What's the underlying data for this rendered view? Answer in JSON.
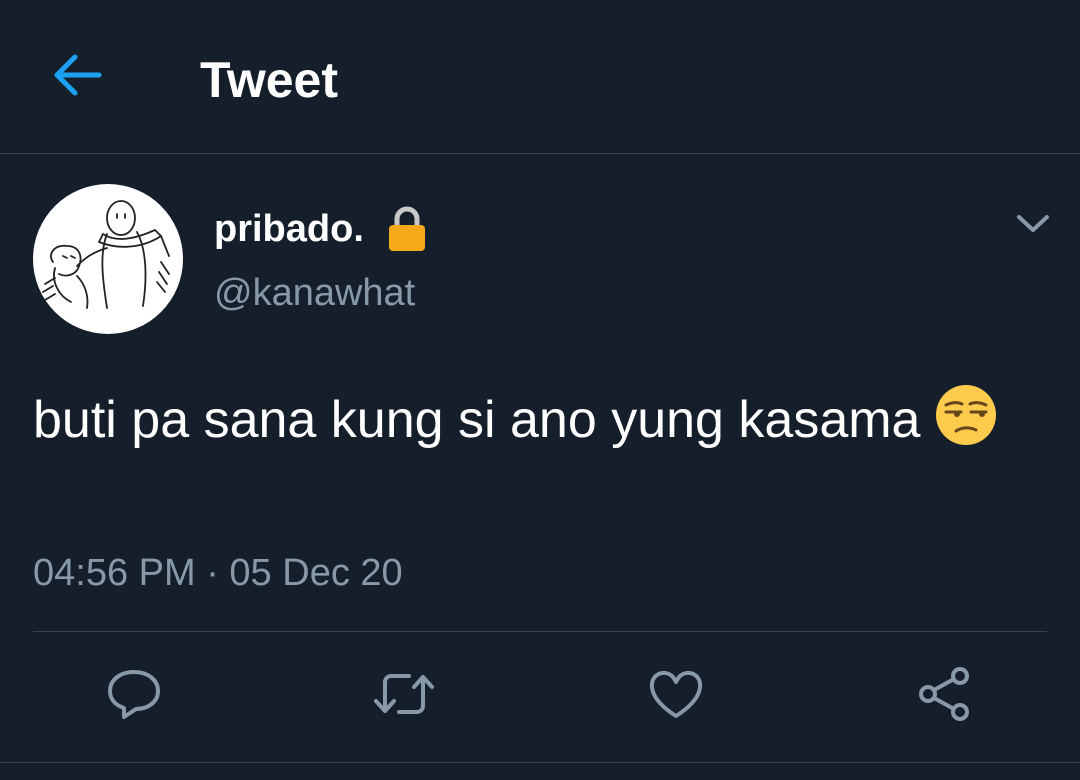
{
  "header": {
    "title": "Tweet",
    "back_icon": "arrow-left-icon"
  },
  "tweet": {
    "display_name": "pribado.",
    "handle": "@kanawhat",
    "protected_icon": "lock-icon",
    "text": "buti pa sana kung si ano yung kasama",
    "text_emoji": "unamused-face-emoji",
    "time": "04:56 PM · 05 Dec 20"
  },
  "actions": [
    {
      "name": "reply",
      "icon": "reply-icon"
    },
    {
      "name": "retweet",
      "icon": "retweet-icon"
    },
    {
      "name": "like",
      "icon": "heart-icon"
    },
    {
      "name": "share",
      "icon": "share-icon"
    }
  ],
  "colors": {
    "background": "#151f2b",
    "accent": "#1da1f2",
    "secondary_text": "#8899a6",
    "divider": "#38444d"
  }
}
